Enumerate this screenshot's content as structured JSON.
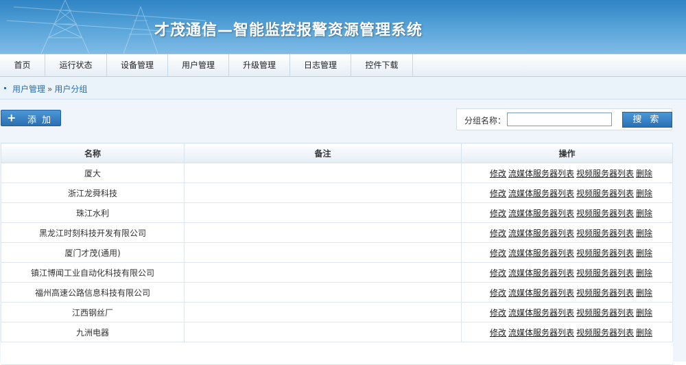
{
  "header": {
    "title": "才茂通信—智能监控报警资源管理系统"
  },
  "nav": {
    "items": [
      "首页",
      "运行状态",
      "设备管理",
      "用户管理",
      "升级管理",
      "日志管理",
      "控件下载"
    ]
  },
  "breadcrumb": {
    "parent": "用户管理",
    "separator": "»",
    "current": "用户分组"
  },
  "toolbar": {
    "add_icon": "+",
    "add_label": "添 加"
  },
  "search": {
    "label": "分组名称：",
    "value": "",
    "placeholder": "",
    "button_label": "搜 索"
  },
  "table": {
    "columns": [
      "名称",
      "备注",
      "操作"
    ],
    "rows": [
      {
        "name": "厦大",
        "note": ""
      },
      {
        "name": "浙江龙舜科技",
        "note": ""
      },
      {
        "name": "珠江水利",
        "note": ""
      },
      {
        "name": "黑龙江时刻科技开发有限公司",
        "note": ""
      },
      {
        "name": "厦门才茂(通用)",
        "note": ""
      },
      {
        "name": "镇江博闻工业自动化科技有限公司",
        "note": ""
      },
      {
        "name": "福州高速公路信息科技有限公司",
        "note": ""
      },
      {
        "name": "江西钢丝厂",
        "note": ""
      },
      {
        "name": "九洲电器",
        "note": ""
      }
    ],
    "actions": [
      "修改",
      "流媒体服务器列表",
      "视频服务器列表",
      "删除"
    ]
  },
  "colors": {
    "accent": "#2a6fb4",
    "header": "#5aa6da",
    "link": "#2a6fb0"
  }
}
